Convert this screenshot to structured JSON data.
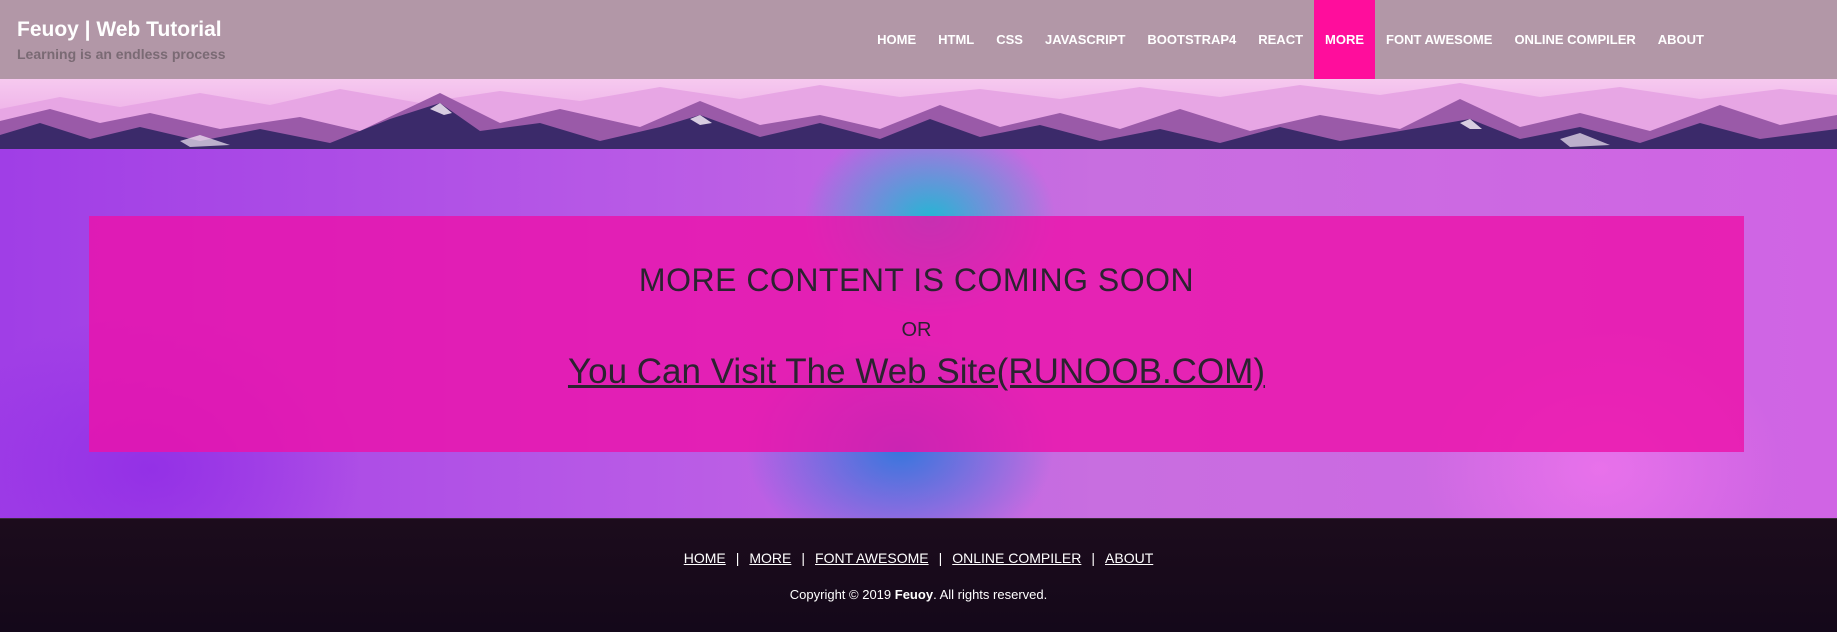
{
  "header": {
    "title": "Feuoy | Web Tutorial",
    "subtitle": "Learning is an endless process",
    "nav": [
      "HOME",
      "HTML",
      "CSS",
      "JAVASCRIPT",
      "BOOTSTRAP4",
      "REACT",
      "MORE",
      "FONT AWESOME",
      "ONLINE COMPILER",
      "ABOUT"
    ],
    "active": "MORE"
  },
  "panel": {
    "heading": "MORE CONTENT IS COMING SOON",
    "or": "OR",
    "link": "You Can Visit The Web Site(RUNOOB.COM)"
  },
  "footer": {
    "links": [
      "HOME",
      "MORE",
      "FONT AWESOME",
      "ONLINE COMPILER",
      "ABOUT"
    ],
    "separator": "|",
    "copyright_prefix": "Copyright © 2019 ",
    "copyright_name": "Feuoy",
    "copyright_suffix": ". All rights reserved."
  },
  "colors": {
    "header_bg": "#b297a7",
    "accent": "#ff0d9c",
    "panel_bg": "#ec12aa"
  }
}
